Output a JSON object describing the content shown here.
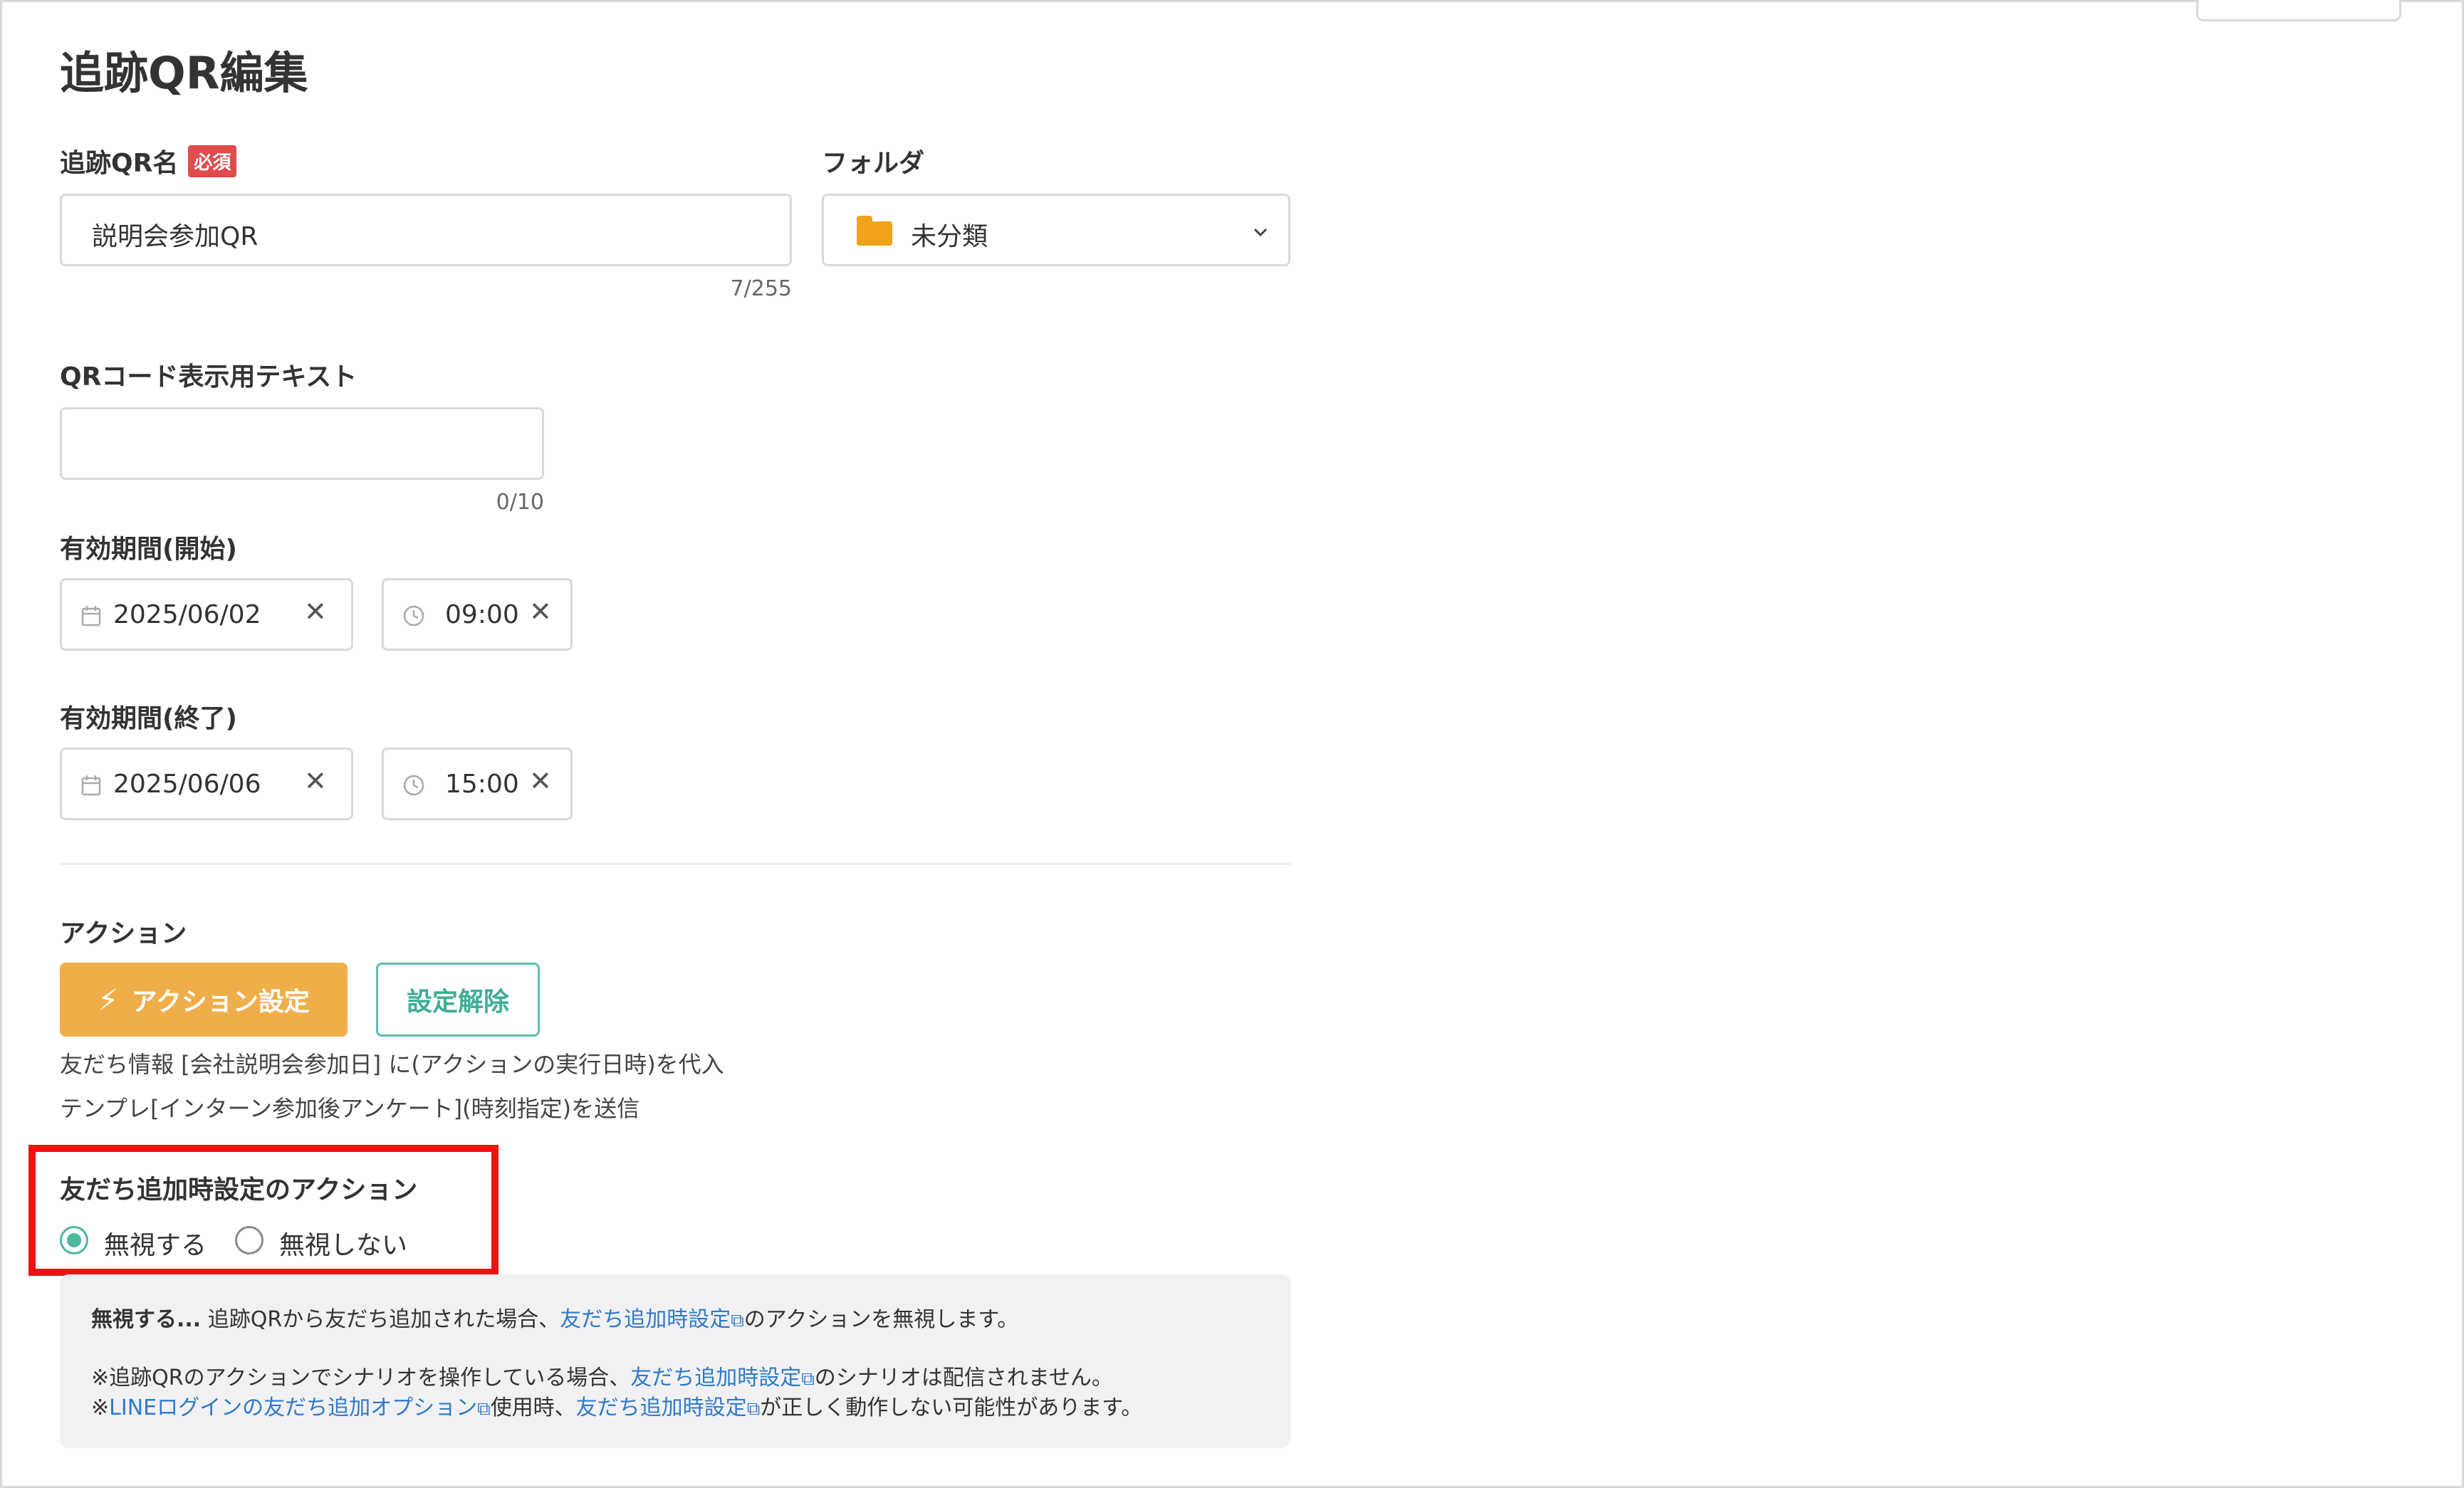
{
  "page": {
    "title": "追跡QR編集"
  },
  "qr_name": {
    "label": "追跡QR名",
    "required_badge": "必須",
    "value": "説明会参加QR",
    "counter": "7/255"
  },
  "folder": {
    "label": "フォルダ",
    "value": "未分類"
  },
  "display_text": {
    "label": "QRコード表示用テキスト",
    "value": "",
    "counter": "0/10"
  },
  "period_start": {
    "label": "有効期間(開始)",
    "date": "2025/06/02",
    "time": "09:00"
  },
  "period_end": {
    "label": "有効期間(終了)",
    "date": "2025/06/06",
    "time": "15:00"
  },
  "action": {
    "label": "アクション",
    "set_button": "アクション設定",
    "clear_button": "設定解除",
    "descriptions": [
      "友だち情報 [会社説明会参加日] に(アクションの実行日時)を代入",
      "テンプレ[インターン参加後アンケート](時刻指定)を送信"
    ]
  },
  "friend_add_action": {
    "label": "友だち追加時設定のアクション",
    "options": [
      "無視する",
      "無視しない"
    ],
    "selected": "無視する"
  },
  "note": {
    "line1_bold": "無視する...",
    "line1_pre": " 追跡QRから友だち追加された場合、",
    "line1_link": "友だち追加時設定",
    "line1_post": "のアクションを無視します。",
    "line2_pre": "※追跡QRのアクションでシナリオを操作している場合、",
    "line2_link": "友だち追加時設定",
    "line2_post": "のシナリオは配信されません。",
    "line3_pre": "※",
    "line3_link1": "LINEログインの友だち追加オプション",
    "line3_mid": "使用時、",
    "line3_link2": "友だち追加時設定",
    "line3_post": "が正しく動作しない可能性があります。"
  },
  "colors": {
    "accent_orange": "#f0ae4a",
    "accent_green": "#4cb89e",
    "link_blue": "#2f7ac9",
    "required_red": "#e04b4b",
    "highlight_red": "#ee1111"
  },
  "icons": [
    "folder-icon",
    "chevron-down-icon",
    "calendar-icon",
    "clock-icon",
    "clear-icon",
    "lightning-icon",
    "external-link-icon"
  ]
}
